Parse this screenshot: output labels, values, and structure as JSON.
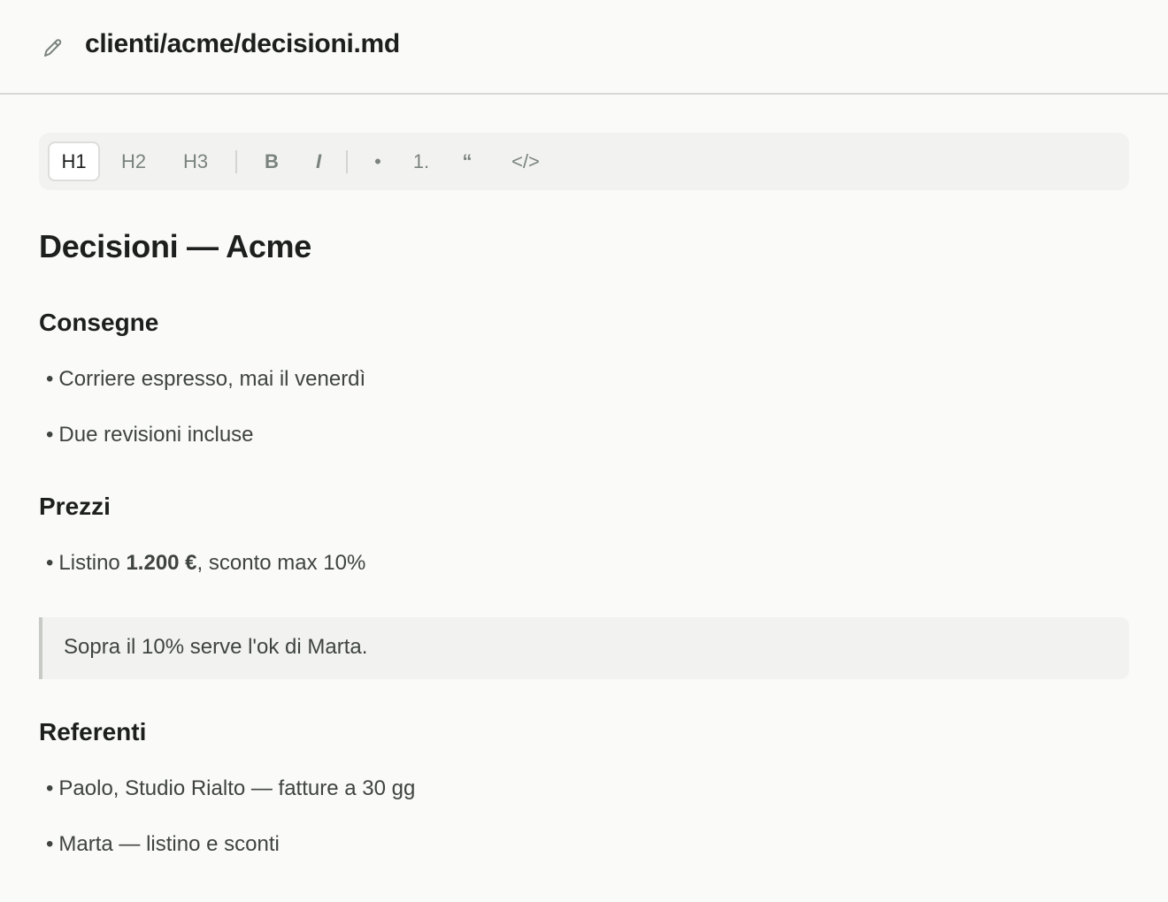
{
  "header": {
    "icon": "pencil-icon",
    "file_path": "clienti/acme/decisioni.md"
  },
  "toolbar": {
    "h1": "H1",
    "h2": "H2",
    "h3": "H3",
    "bold": "B",
    "italic": "I",
    "bullet_list": "•",
    "numbered_list": "1.",
    "quote": "“",
    "code": "</>"
  },
  "document": {
    "title": "Decisioni — Acme",
    "sections": [
      {
        "heading": "Consegne",
        "items": [
          "Corriere espresso, mai il venerdì",
          "Due revisioni incluse"
        ]
      },
      {
        "heading": "Prezzi",
        "items": [
          {
            "before": "Listino ",
            "bold": "1.200 €",
            "after": ", sconto max 10%"
          }
        ],
        "quote": "Sopra il 10% serve l'ok di Marta."
      },
      {
        "heading": "Referenti",
        "items": [
          "Paolo, Studio Rialto — fatture a 30 gg",
          "Marta — listino e sconti"
        ]
      }
    ]
  },
  "bullet_glyph": "•"
}
